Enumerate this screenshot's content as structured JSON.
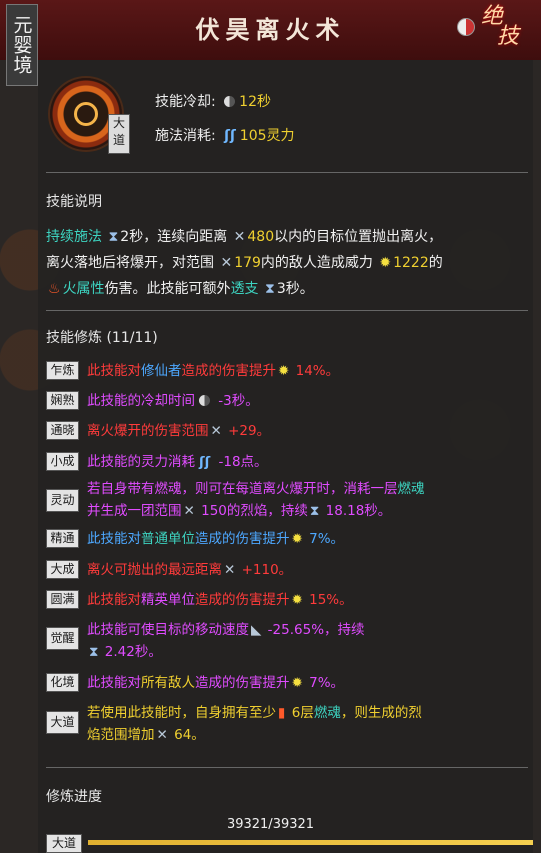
{
  "realm_badge": "元婴境",
  "title": "伏昊离火术",
  "corner": {
    "line1": "绝",
    "line2": "技"
  },
  "skill_tag": "大道",
  "stats": {
    "cooldown_label": "技能冷却:",
    "cooldown_value": "12秒",
    "cost_label": "施法消耗:",
    "cost_value": "105灵力"
  },
  "description": {
    "title": "技能说明",
    "line1": {
      "a": "持续施法",
      "b": "2秒，连续向距离",
      "c": "480",
      "d": "以内的目标位置抛出离火，"
    },
    "line2": {
      "a": "离火落地后将爆开，对范围",
      "b": "179",
      "c": "内的敌人造成威力",
      "d": "1222",
      "e": "的"
    },
    "line3": {
      "a": "火属性",
      "b": "伤害。此技能可额外",
      "c": "透支",
      "d": "3秒。"
    }
  },
  "mods": {
    "title": "技能修炼 (11/11)",
    "items": [
      {
        "badge": "乍炼",
        "seg": [
          "此技能对",
          "修仙者",
          "造成的伤害提升",
          " 14%。"
        ]
      },
      {
        "badge": "娴熟",
        "seg": [
          "此技能的冷却时间",
          " -3秒。"
        ]
      },
      {
        "badge": "通晓",
        "seg": [
          "离火爆开的伤害范围",
          " +29。"
        ]
      },
      {
        "badge": "小成",
        "seg": [
          "此技能的灵力消耗",
          " -18点。"
        ]
      },
      {
        "badge": "灵动",
        "seg": [
          "若自身带有燃魂，则可在每道离火爆开时，消耗一层",
          "燃魂",
          "并生成一团范围",
          " 150",
          "的烈焰，持续",
          " 18.18秒。"
        ]
      },
      {
        "badge": "精通",
        "seg": [
          "此技能对",
          "普通单位",
          "造成的伤害提升",
          " 7%。"
        ]
      },
      {
        "badge": "大成",
        "seg": [
          "离火可抛出的最远距离",
          " +110。"
        ]
      },
      {
        "badge": "圆满",
        "seg": [
          "此技能对",
          "精英单位",
          "造成的伤害提升",
          " 15%。"
        ]
      },
      {
        "badge": "觉醒",
        "seg": [
          "此技能可使目标的移动速度",
          " -25.65%，持续",
          " 2.42秒。"
        ]
      },
      {
        "badge": "化境",
        "seg": [
          "此技能对",
          "所有敌人",
          "造成的伤害提升",
          " 7%。"
        ]
      },
      {
        "badge": "大道",
        "seg": [
          "若使用此技能时，自身拥有至少",
          " 6层",
          "燃魂",
          "，则生成的烈",
          "焰范围增加",
          " 64。"
        ]
      }
    ]
  },
  "progress": {
    "title": "修炼进度",
    "value": "39321/39321",
    "badge": "大道",
    "fraction": 1.0
  },
  "colors": {
    "header": "#5a1717",
    "highlight_cyan": "#3dd3c0",
    "highlight_yellow": "#f0d030",
    "red": "#ff3b3b",
    "blue": "#4da8ff",
    "pink": "#e04cff"
  }
}
